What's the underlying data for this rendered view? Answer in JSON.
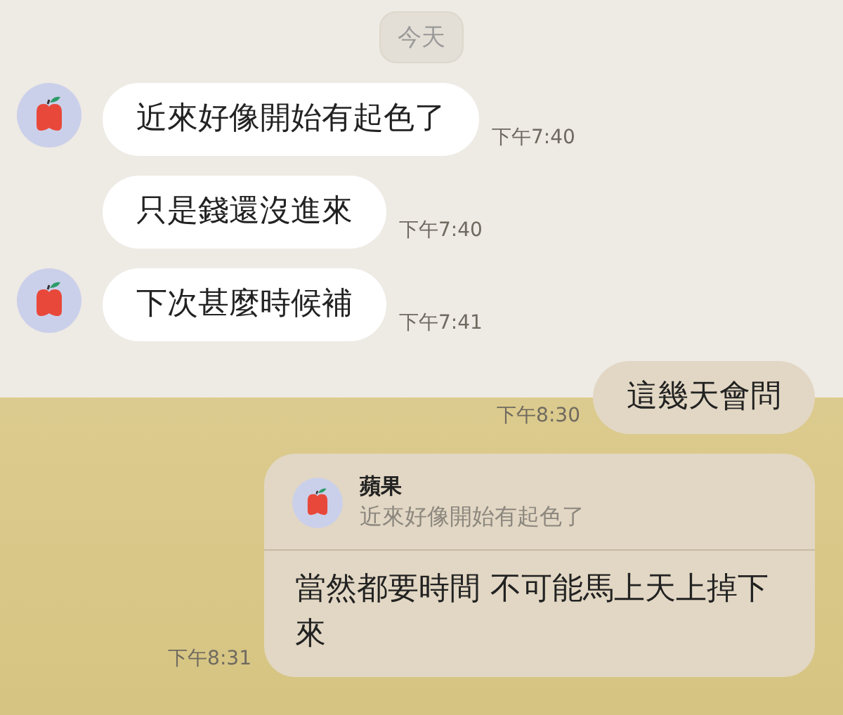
{
  "date_chip": "今天",
  "messages": [
    {
      "kind": "incoming",
      "show_avatar": true,
      "text": "近來好像開始有起色了",
      "time": "下午7:40"
    },
    {
      "kind": "incoming",
      "show_avatar": false,
      "text": "只是錢還沒進來",
      "time": "下午7:40"
    },
    {
      "kind": "incoming",
      "show_avatar": true,
      "text": "下次甚麼時候補",
      "time": "下午7:41"
    },
    {
      "kind": "outgoing",
      "text": "這幾天會問",
      "time": "下午8:30"
    },
    {
      "kind": "reply",
      "quote_name": "蘋果",
      "quote_text": "近來好像開始有起色了",
      "text": "當然都要時間 不可能馬上天上掉下來",
      "time": "下午8:31"
    }
  ]
}
